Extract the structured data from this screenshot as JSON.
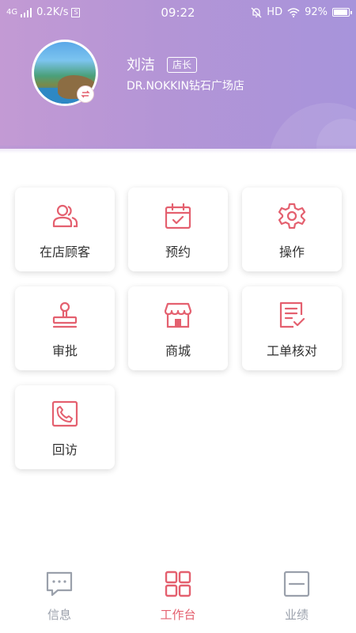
{
  "status_bar": {
    "network": "4G",
    "speed": "0.2K/s",
    "s_badge": "S",
    "time": "09:22",
    "hd": "HD",
    "battery": "92%",
    "battery_level": 0.92
  },
  "profile": {
    "name": "刘洁",
    "role": "店长",
    "store": "DR.NOKKIN钻石广场店"
  },
  "grid": [
    {
      "label": "在店顾客",
      "icon": "customers-icon"
    },
    {
      "label": "预约",
      "icon": "calendar-icon"
    },
    {
      "label": "操作",
      "icon": "gear-icon"
    },
    {
      "label": "审批",
      "icon": "stamp-icon"
    },
    {
      "label": "商城",
      "icon": "shop-icon"
    },
    {
      "label": "工单核对",
      "icon": "checklist-icon"
    },
    {
      "label": "回访",
      "icon": "phone-icon"
    }
  ],
  "tabs": [
    {
      "label": "信息",
      "icon": "message-icon",
      "active": false
    },
    {
      "label": "工作台",
      "icon": "grid-icon",
      "active": true
    },
    {
      "label": "业绩",
      "icon": "performance-icon",
      "active": false
    }
  ],
  "colors": {
    "accent": "#e4606f",
    "tab_inactive": "#9aa0ab",
    "header_start": "#c39ad4",
    "header_end": "#a794db"
  }
}
